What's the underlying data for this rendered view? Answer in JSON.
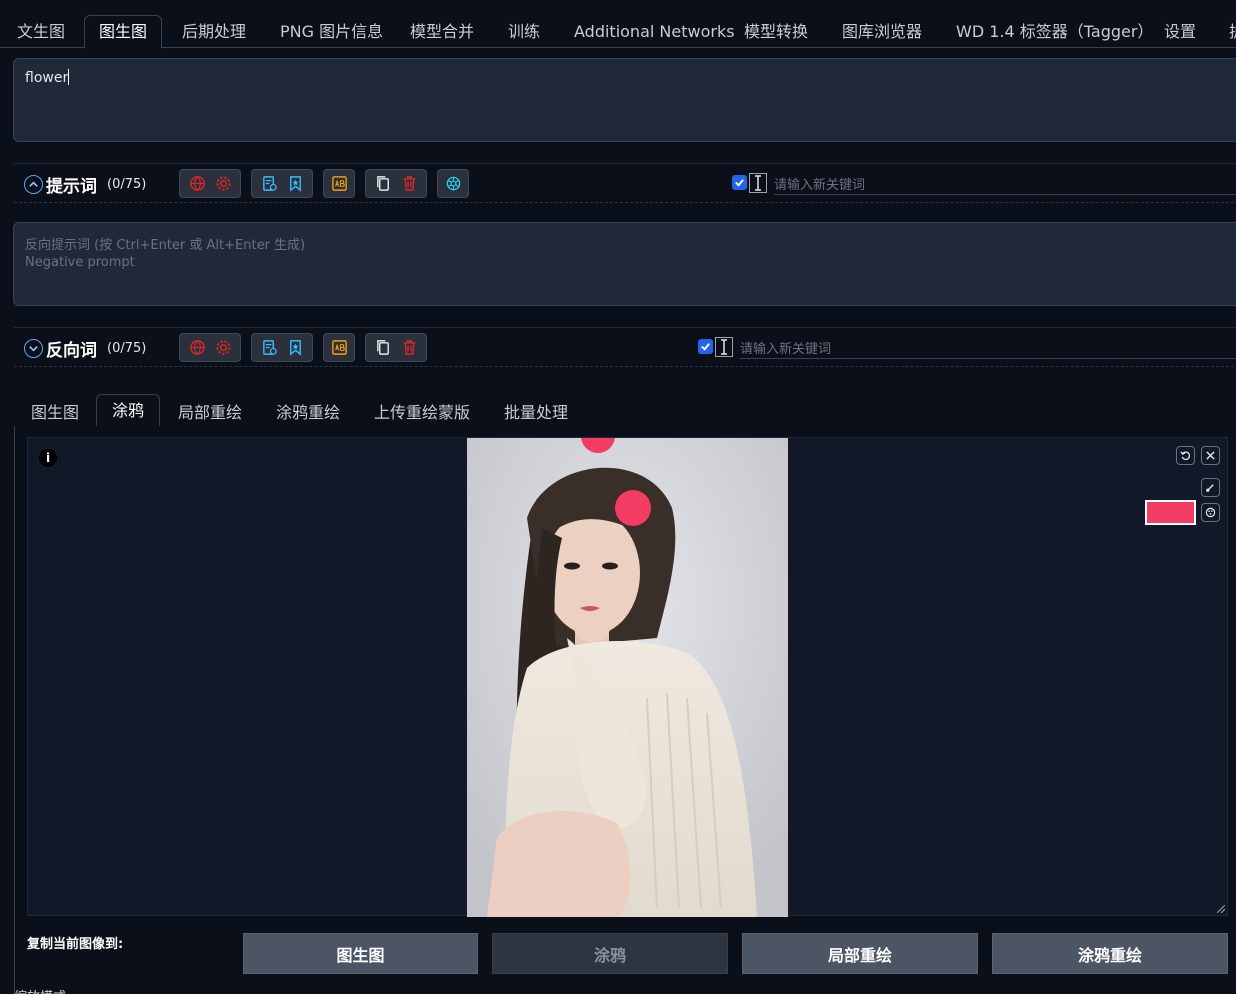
{
  "top_tabs": [
    "文生图",
    "图生图",
    "后期处理",
    "PNG 图片信息",
    "模型合并",
    "训练",
    "Additional Networks",
    "模型转换",
    "图库浏览器",
    "WD 1.4 标签器（Tagger）",
    "设置",
    "扩"
  ],
  "prompt": {
    "value": "flower"
  },
  "prompt_toolbar": {
    "label": "提示词",
    "count": "(0/75)",
    "keyword_placeholder": "请输入新关键词"
  },
  "negative": {
    "placeholder_line1": "反向提示词 (按 Ctrl+Enter 或 Alt+Enter 生成)",
    "placeholder_line2": "Negative prompt"
  },
  "negative_toolbar": {
    "label": "反向词",
    "count": "(0/75)",
    "keyword_placeholder": "请输入新关键词"
  },
  "sub_tabs": [
    "图生图",
    "涂鸦",
    "局部重绘",
    "涂鸦重绘",
    "上传重绘蒙版",
    "批量处理"
  ],
  "canvas": {
    "info": "i",
    "brush_color": "#f23c64"
  },
  "copy_row": {
    "label": "复制当前图像到:",
    "buttons": [
      "图生图",
      "涂鸦",
      "局部重绘",
      "涂鸦重绘"
    ]
  },
  "bottom_text": "缩放模式"
}
